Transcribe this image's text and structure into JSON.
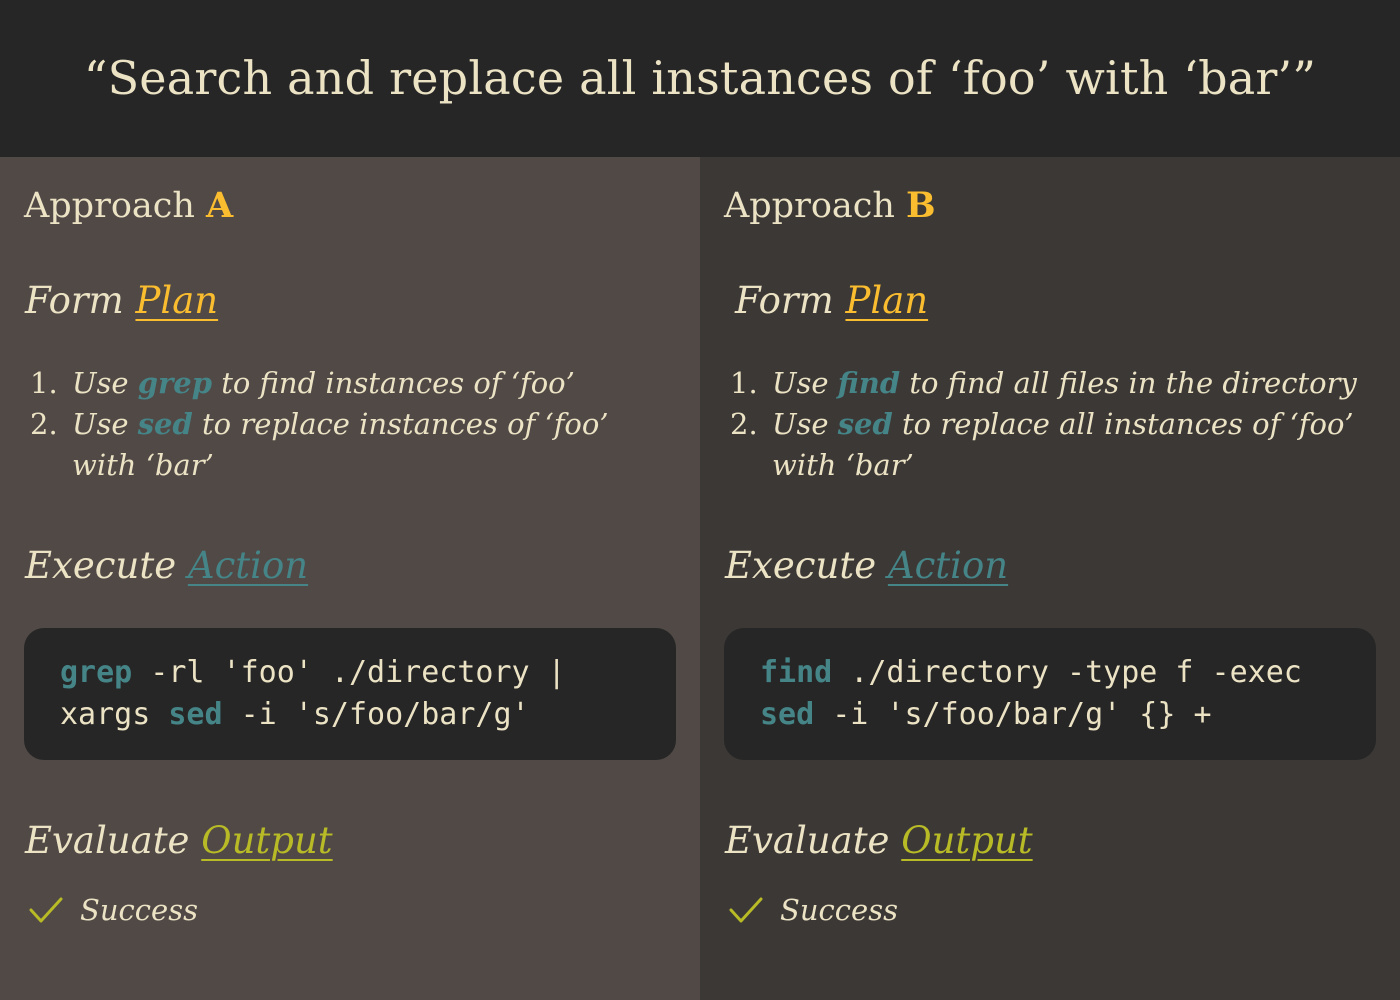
{
  "title": "“Search and replace all instances of ‘foo’ with ‘bar’”",
  "colors": {
    "header_bg": "#262626",
    "panel_a_bg": "#504946",
    "panel_b_bg": "#3c3836",
    "text": "#ece3c5",
    "yellow_accent": "#fabd2f",
    "teal_accent": "#458588",
    "green_accent": "#b8bb26"
  },
  "panels": [
    {
      "approach_label": "Approach",
      "approach_letter": "A",
      "plan": {
        "head_prefix": "Form",
        "head_accent": "Plan",
        "steps": [
          {
            "num": "1.",
            "pre": "Use",
            "tool": "grep",
            "post": "to find instances of ‘foo’"
          },
          {
            "num": "2.",
            "pre": "Use",
            "tool": "sed",
            "post": "to replace instances of ‘foo’ with ‘bar’"
          }
        ]
      },
      "action": {
        "head_prefix": "Execute",
        "head_accent": "Action",
        "code": [
          [
            {
              "kw": "grep"
            },
            {
              "t": " -rl 'foo' ./directory |"
            }
          ],
          [
            {
              "t": "xargs "
            },
            {
              "kw": "sed"
            },
            {
              "t": " -i 's/foo/bar/g'"
            }
          ]
        ]
      },
      "output": {
        "head_prefix": "Evaluate",
        "head_accent": "Output",
        "result_icon": "checkmark-icon",
        "result_label": "Success"
      }
    },
    {
      "approach_label": "Approach",
      "approach_letter": "B",
      "plan": {
        "head_prefix": "Form",
        "head_accent": "Plan",
        "steps": [
          {
            "num": "1.",
            "pre": "Use",
            "tool": "find",
            "post": "to find all files in the directory"
          },
          {
            "num": "2.",
            "pre": "Use",
            "tool": "sed",
            "post": "to replace all instances of ‘foo’ with ‘bar’"
          }
        ]
      },
      "action": {
        "head_prefix": "Execute",
        "head_accent": "Action",
        "code": [
          [
            {
              "kw": "find"
            },
            {
              "t": " ./directory -type f -exec"
            }
          ],
          [
            {
              "kw": "sed"
            },
            {
              "t": " -i 's/foo/bar/g' {} +"
            }
          ]
        ]
      },
      "output": {
        "head_prefix": "Evaluate",
        "head_accent": "Output",
        "result_icon": "checkmark-icon",
        "result_label": "Success"
      }
    }
  ]
}
